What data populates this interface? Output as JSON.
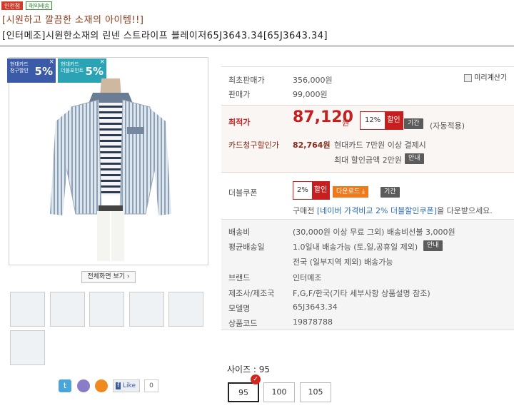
{
  "badges": {
    "a": "인천점",
    "b": "해외배송"
  },
  "promo": "[시원하고 깔끔한 소재의 아이템!!]",
  "title": "[인터메조]시원한소재의 린넨 스트라이프 블레이저65J3643.34[65J3643.34]",
  "cards": [
    {
      "line1": "현대카드",
      "line2": "청구할인",
      "pct": "5%",
      "color": "#3b5aa8"
    },
    {
      "line1": "현대카드",
      "line2": "더블포인트",
      "pct": "5%",
      "color": "#2aa3b4"
    }
  ],
  "card_close": "×",
  "fullscreen_button": "전체화면 보기 ›",
  "price_calc": "미리계산기",
  "original_price": {
    "label": "최초판매가",
    "value": "356,000원"
  },
  "sale_price": {
    "label": "판매가",
    "value": "99,000원"
  },
  "best_price": {
    "label": "최적가",
    "value": "87,120",
    "unit": "원",
    "pct": "12%",
    "tag": "할인",
    "period": "기간",
    "note": "(자동적용)"
  },
  "card_discount": {
    "label": "카드청구할인가",
    "value": "82,764원",
    "desc": "현대카드 7만원 이상 결제시",
    "max": "최대 할인금액 2만원",
    "info": "안내"
  },
  "double_coupon": {
    "label": "더블쿠폰",
    "pct": "2%",
    "tag": "할인",
    "download": "다운로드",
    "period": "기간",
    "note_prefix": "구매전",
    "note_link": "[네이버 가격비교 2% 더블할인쿠폰]",
    "note_suffix": "을 다운받으세요."
  },
  "shipping": {
    "label": "배송비",
    "value": "(30,000원 이상 무료 그외) 배송비선불 3,000원"
  },
  "avg_delivery": {
    "label": "평균배송일",
    "value": "1.0일내 배송가능 (토,일,공휴일 제외)",
    "info": "안내",
    "value2": "전국 (일부지역 제외) 배송가능"
  },
  "brand": {
    "label": "브랜드",
    "value": "인터메조"
  },
  "maker": {
    "label": "제조사/제조국",
    "value": "F,G,F/한국(기타 세부사항 상품설명 참조)"
  },
  "model": {
    "label": "모델명",
    "value": "65J3643.34"
  },
  "code": {
    "label": "상품코드",
    "value": "19878788"
  },
  "size_label": "사이즈 : 95",
  "sizes": [
    "95",
    "100",
    "105"
  ],
  "social": {
    "like": "Like",
    "count": "0"
  }
}
